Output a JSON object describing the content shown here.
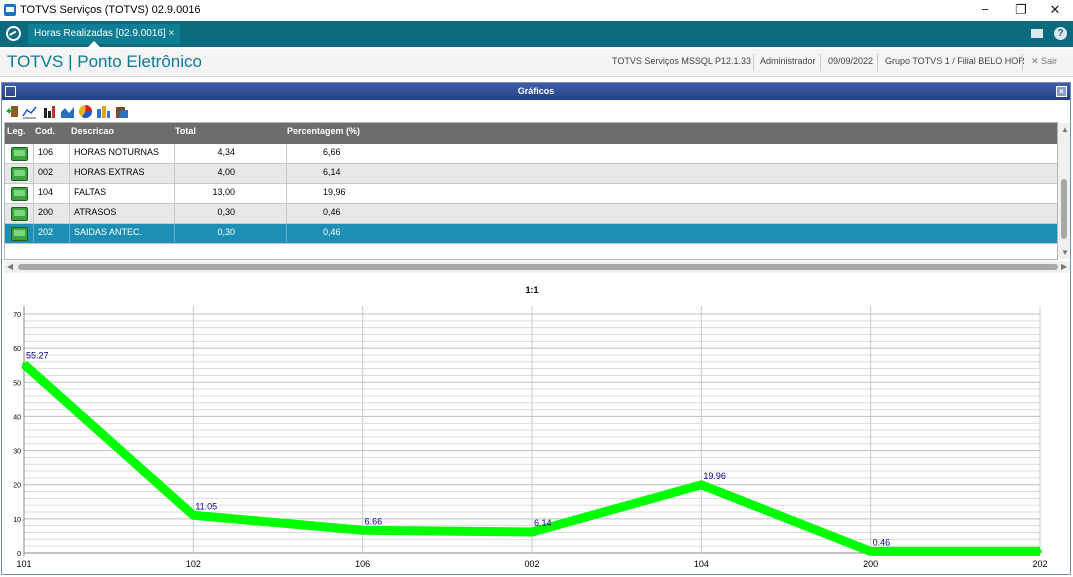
{
  "window": {
    "title": "TOTVS Serviços (TOTVS) 02.9.0016",
    "min": "−",
    "restore": "❐",
    "close": "✕"
  },
  "tabbar": {
    "tab_label": "Horas Realizadas [02.9.0016] ×"
  },
  "header": {
    "brand": "TOTVS | Ponto Eletrônico",
    "environment": "TOTVS Serviços MSSQL P12.1.33",
    "user": "Administrador",
    "date": "09/09/2022",
    "branch": "Grupo TOTVS 1 / Filial BELO HOR",
    "exit_label": "✕ Sair"
  },
  "dialog": {
    "title": "Gráficos"
  },
  "toolbar": {
    "icons": [
      "exit-icon",
      "line-chart-icon",
      "bar-chart-icon",
      "area-chart-icon",
      "pie-chart-icon",
      "bar-3d-icon",
      "print-icon"
    ]
  },
  "table": {
    "columns": [
      "Leg.",
      "Cod.",
      "Descricao",
      "Total",
      "Percentagem (%)"
    ],
    "rows": [
      {
        "cod": "106",
        "descricao": "HORAS NOTURNAS",
        "total": "4,34",
        "perc": "6,66"
      },
      {
        "cod": "002",
        "descricao": "HORAS EXTRAS",
        "total": "4,00",
        "perc": "6,14"
      },
      {
        "cod": "104",
        "descricao": "FALTAS",
        "total": "13,00",
        "perc": "19,96"
      },
      {
        "cod": "200",
        "descricao": "ATRASOS",
        "total": "0,30",
        "perc": "0,46"
      },
      {
        "cod": "202",
        "descricao": "SAIDAS ANTEC.",
        "total": "0,30",
        "perc": "0,46"
      }
    ],
    "selected_row": 4
  },
  "chart_data": {
    "type": "line",
    "title": "1:1",
    "categories": [
      "101",
      "102",
      "106",
      "002",
      "104",
      "200",
      "202"
    ],
    "series": [
      {
        "values": [
          55.27,
          11.05,
          6.66,
          6.14,
          19.96,
          0.46,
          0.46
        ]
      }
    ],
    "data_labels": [
      "55.27",
      "11.05",
      "6.66",
      "6.14",
      "19.96",
      "0.46"
    ],
    "y_ticks": [
      "0",
      "10",
      "20",
      "30",
      "40",
      "50",
      "60",
      "70"
    ],
    "ylim": [
      0,
      70
    ],
    "grid": true,
    "line_color": "#00ff00",
    "label_color": "#00008b"
  },
  "colors": {
    "accent": "#0c6a7f",
    "brand": "#0c7a95",
    "selected_row": "#1e8fb4"
  }
}
